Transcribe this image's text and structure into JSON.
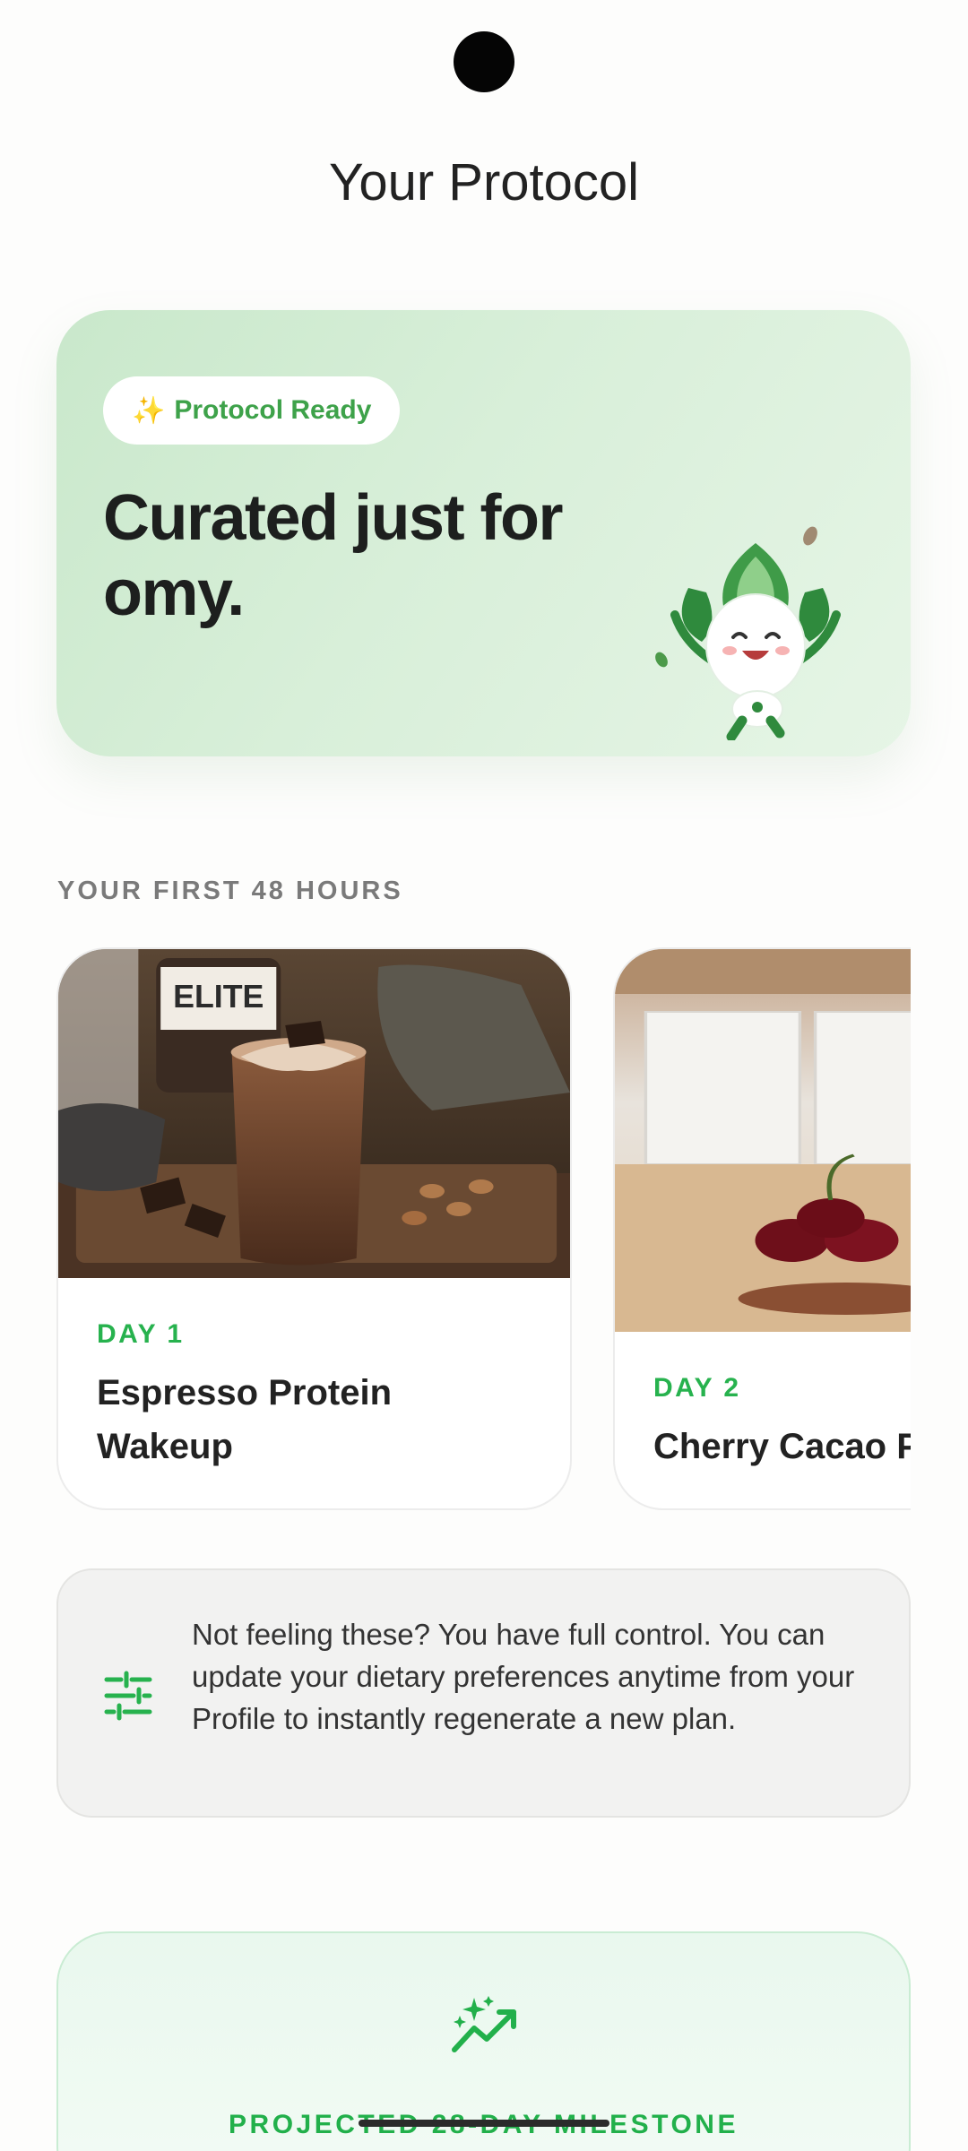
{
  "header": {
    "title": "Your Protocol"
  },
  "hero": {
    "badge_icon": "✨",
    "badge_label": "Protocol Ready",
    "heading": "Curated just for omy."
  },
  "section": {
    "label": "YOUR FIRST 48 HOURS"
  },
  "meals": [
    {
      "day": "DAY 1",
      "name": "Espresso Protein Wakeup"
    },
    {
      "day": "DAY 2",
      "name": "Cherry Cacao Protein"
    }
  ],
  "info": {
    "text": "Not feeling these? You have full control. You can update your dietary preferences anytime from your Profile to instantly regenerate a new plan."
  },
  "milestone": {
    "label": "PROJECTED 28-DAY MILESTONE"
  },
  "colors": {
    "accent": "#27b24e",
    "hero_bg": "#d4edd5",
    "info_bg": "#f2f2f1"
  }
}
